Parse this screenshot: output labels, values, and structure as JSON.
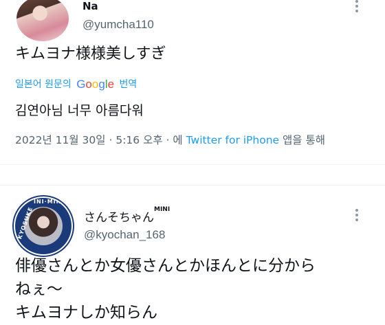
{
  "tweets": [
    {
      "display_name": "Na",
      "handle": "@yumcha110",
      "text": "キムヨナ様様美しすぎ",
      "translate": {
        "prefix": "일본어 원문의",
        "logo": {
          "G": "G",
          "o1": "o",
          "o2": "o",
          "g": "g",
          "l": "l",
          "e": "e"
        },
        "suffix": "번역"
      },
      "translated_text": "김연아님 너무 아름다워",
      "meta": {
        "date": "2022년 11월 30일",
        "separator": "·",
        "time": "5:16 오후",
        "via_prefix": "에",
        "source": "Twitter for iPhone",
        "via_suffix": "앱을 통해"
      },
      "avatar_icon": "profile-photo"
    },
    {
      "display_name": "さんそちゃん",
      "display_name_sup": "MINI",
      "handle": "@kyochan_168",
      "avatar_ring_top": "INI·MINI",
      "avatar_ring_left": "KYOSUKE",
      "text_lines": [
        "俳優さんとか女優さんとかほんとに分から",
        "ねぇ～",
        "キムヨナしか知らん"
      ],
      "avatar_icon": "profile-photo"
    }
  ],
  "colors": {
    "link": "#1d9bf0",
    "secondary_text": "#536471",
    "primary_text": "#0f1419",
    "divider": "#eff3f4"
  }
}
